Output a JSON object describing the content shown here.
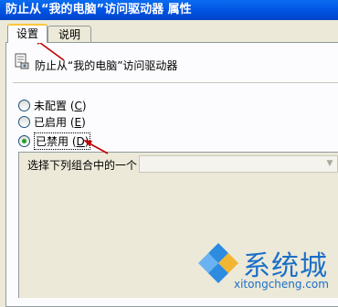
{
  "window": {
    "title": "防止从“我的电脑”访问驱动器 属性"
  },
  "tabs": [
    {
      "label": "设置",
      "active": true
    },
    {
      "label": "说明",
      "active": false
    }
  ],
  "policy": {
    "name": "防止从“我的电脑”访问驱动器",
    "icon": "policy-document-icon"
  },
  "options": [
    {
      "label": "未配置",
      "key": "C",
      "selected": false
    },
    {
      "label": "已启用",
      "key": "E",
      "selected": false
    },
    {
      "label": "已禁用",
      "key": "D",
      "selected": true
    }
  ],
  "combo": {
    "label": "选择下列组合中的一个",
    "value": ""
  },
  "watermark": {
    "text": "系统城",
    "url": "xitongcheng.com"
  },
  "colors": {
    "titlebar": "#0050e0",
    "annotation_arrow": "#c00000",
    "watermark": "#1b6fc8"
  }
}
